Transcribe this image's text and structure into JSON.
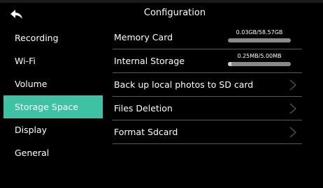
{
  "header": {
    "title": "Configuration",
    "back_icon": "back-arrow-icon"
  },
  "sidebar": {
    "items": [
      {
        "label": "Recording",
        "active": false
      },
      {
        "label": "Wi-Fi",
        "active": false
      },
      {
        "label": "Volume",
        "active": false
      },
      {
        "label": "Storage Space",
        "active": true
      },
      {
        "label": "Display",
        "active": false
      },
      {
        "label": "General",
        "active": false
      }
    ]
  },
  "content": {
    "memory_card": {
      "label": "Memory Card",
      "usage": "0.03GB/58.57GB",
      "fraction": 0.0005
    },
    "internal_storage": {
      "label": "Internal Storage",
      "usage": "0.25MB/5.00MB",
      "fraction": 0.05
    },
    "backup": {
      "label": "Back up local photos to SD card",
      "icon": "chevron-right-icon"
    },
    "files_deletion": {
      "label": "Files Deletion",
      "icon": "chevron-right-icon"
    },
    "format_sdcard": {
      "label": "Format Sdcard",
      "icon": "chevron-right-icon"
    }
  },
  "colors": {
    "accent": "#3fc2a4",
    "background": "#000000",
    "divider": "#5a5a5a"
  }
}
